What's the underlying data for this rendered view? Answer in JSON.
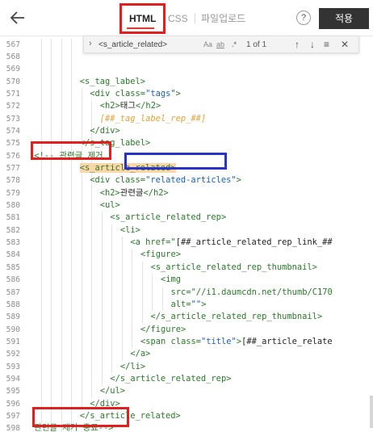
{
  "toolbar": {
    "tabs": {
      "html": "HTML",
      "css": "CSS",
      "upload": "파일업로드"
    },
    "help": "?",
    "apply": "적용"
  },
  "find": {
    "query": "<s_article_related>",
    "aa": "Aa",
    "ab": "ab",
    "regex": ".*",
    "count": "1 of 1"
  },
  "lines": [
    {
      "n": "567",
      "indent": 0,
      "code": ""
    },
    {
      "n": "568",
      "indent": 0,
      "code": ""
    },
    {
      "n": "569",
      "indent": 0,
      "code": ""
    },
    {
      "n": "570",
      "indent": 10,
      "code": "<s_tag_label>"
    },
    {
      "n": "571",
      "indent": 12,
      "code": "<div class=\"tags\">"
    },
    {
      "n": "572",
      "indent": 14,
      "code": "<h2>태그</h2>"
    },
    {
      "n": "573",
      "indent": 14,
      "code": "[##_tag_label_rep_##]"
    },
    {
      "n": "574",
      "indent": 12,
      "code": "</div>"
    },
    {
      "n": "575",
      "indent": 10,
      "code": "</s_tag_label>"
    },
    {
      "n": "576",
      "indent": 1,
      "code": "<!-- 관련글 제거"
    },
    {
      "n": "577",
      "indent": 10,
      "code": "<s_article_related>"
    },
    {
      "n": "578",
      "indent": 12,
      "code": "<div class=\"related-articles\">"
    },
    {
      "n": "579",
      "indent": 14,
      "code": "<h2>관련글</h2>"
    },
    {
      "n": "580",
      "indent": 14,
      "code": "<ul>"
    },
    {
      "n": "581",
      "indent": 16,
      "code": "<s_article_related_rep>"
    },
    {
      "n": "582",
      "indent": 18,
      "code": "<li>"
    },
    {
      "n": "583",
      "indent": 20,
      "code": "<a href=\"[##_article_related_rep_link_##"
    },
    {
      "n": "584",
      "indent": 22,
      "code": "<figure>"
    },
    {
      "n": "585",
      "indent": 24,
      "code": "<s_article_related_rep_thumbnail>"
    },
    {
      "n": "586",
      "indent": 26,
      "code": "<img"
    },
    {
      "n": "587",
      "indent": 28,
      "code": "src=\"//i1.daumcdn.net/thumb/C170"
    },
    {
      "n": "588",
      "indent": 28,
      "code": "alt=\"\">"
    },
    {
      "n": "589",
      "indent": 24,
      "code": "</s_article_related_rep_thumbnail>"
    },
    {
      "n": "590",
      "indent": 22,
      "code": "</figure>"
    },
    {
      "n": "591",
      "indent": 22,
      "code": "<span class=\"title\">[##_article_relate"
    },
    {
      "n": "592",
      "indent": 20,
      "code": "</a>"
    },
    {
      "n": "593",
      "indent": 18,
      "code": "</li>"
    },
    {
      "n": "594",
      "indent": 16,
      "code": "</s_article_related_rep>"
    },
    {
      "n": "595",
      "indent": 14,
      "code": "</ul>"
    },
    {
      "n": "596",
      "indent": 12,
      "code": "</div>"
    },
    {
      "n": "597",
      "indent": 10,
      "code": "</s_article_related>"
    },
    {
      "n": "598",
      "indent": 1,
      "code": "관련글 제거 종료-->"
    }
  ],
  "colors": {
    "annotation_red": "#e21f1f",
    "annotation_blue": "#2834c9",
    "tag_green": "#2b7c2b",
    "value_blue": "#1a5fb4",
    "template_orange": "#e6a23c",
    "match_highlight": "#fbd6a8",
    "apply_button": "#333333",
    "active_tab_underline": "#e03c31"
  }
}
